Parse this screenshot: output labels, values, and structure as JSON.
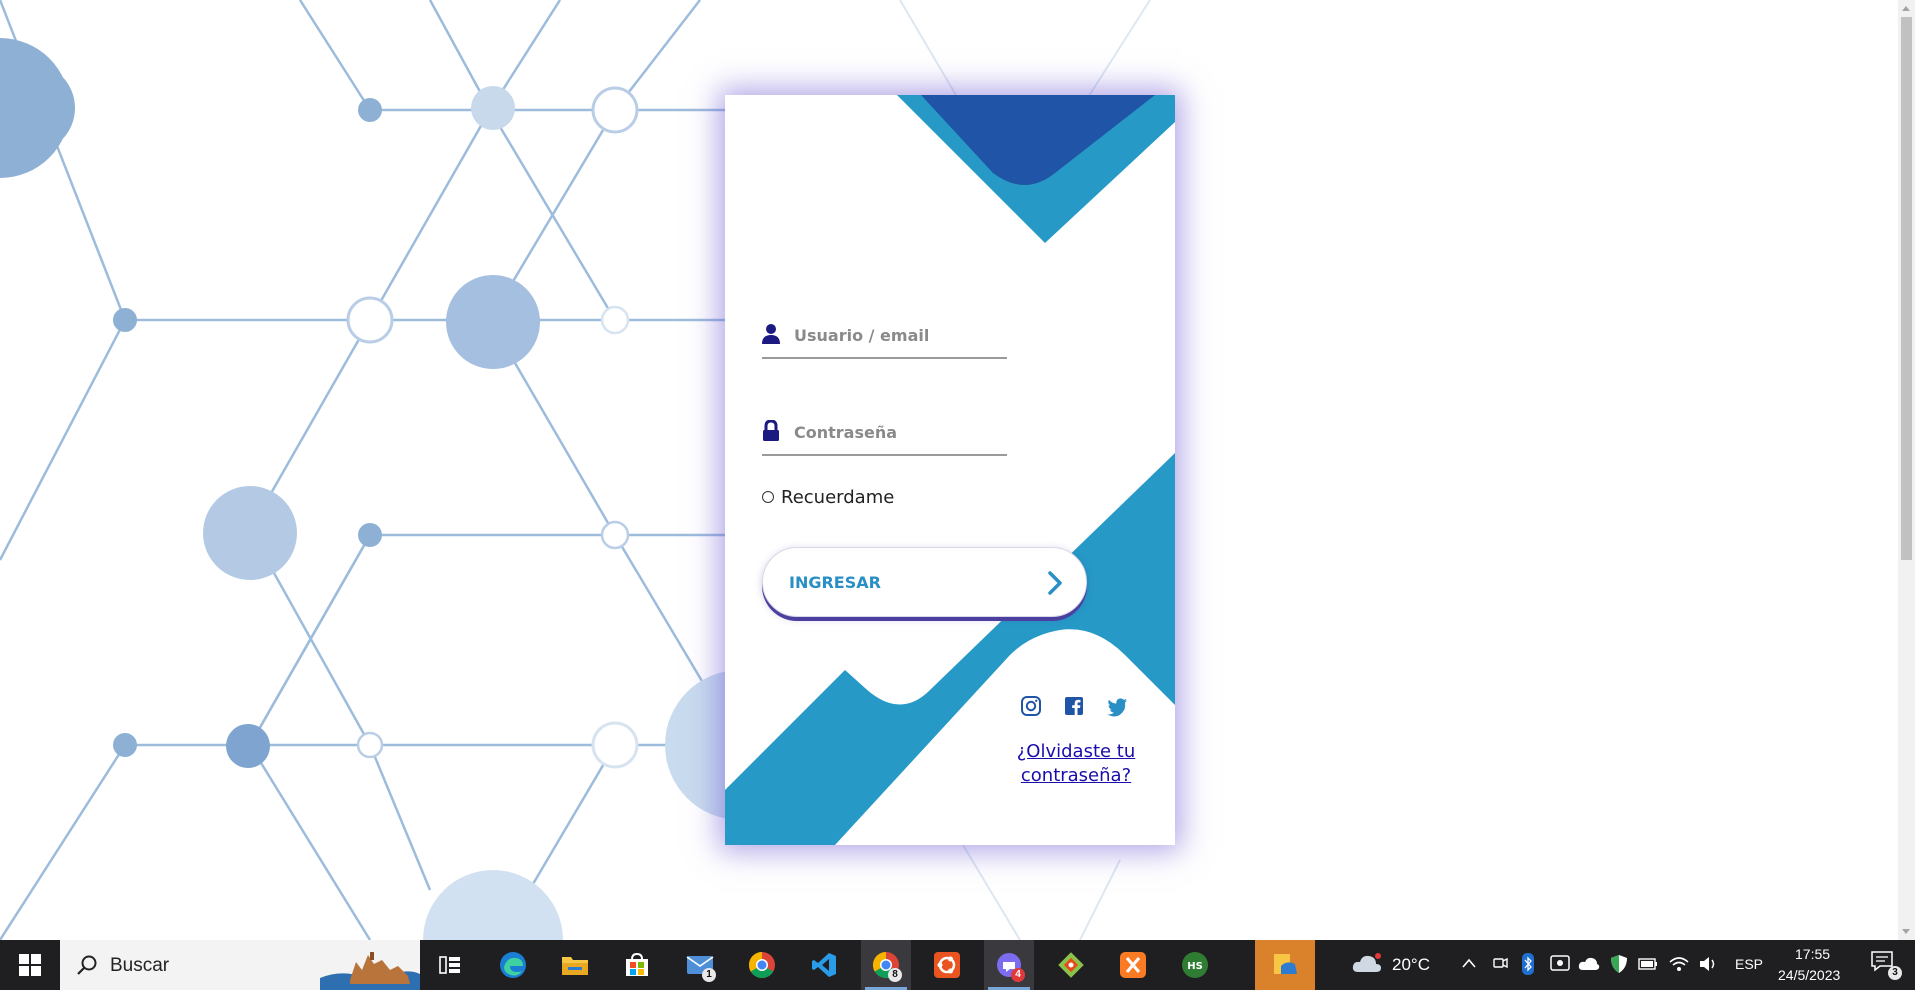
{
  "login": {
    "username_placeholder": "Usuario / email",
    "password_placeholder": "Contraseña",
    "remember_label": "Recuerdame",
    "submit_label": "INGRESAR",
    "forgot_line1": "¿Olvidaste tu",
    "forgot_line2": "contraseña?",
    "social_icons": [
      "instagram-icon",
      "facebook-icon",
      "twitter-icon"
    ]
  },
  "colors": {
    "accent_blue": "#2699c7",
    "dark_blue": "#2054a6",
    "icon_navy": "#1b1a80",
    "button_text": "#2a8fc4"
  },
  "taskbar": {
    "search_placeholder": "Buscar",
    "apps": [
      {
        "name": "task-view-icon",
        "badge": ""
      },
      {
        "name": "edge-icon",
        "badge": ""
      },
      {
        "name": "file-explorer-icon",
        "badge": ""
      },
      {
        "name": "microsoft-store-icon",
        "badge": ""
      },
      {
        "name": "mail-icon",
        "badge": "1"
      },
      {
        "name": "chrome-icon",
        "badge": ""
      },
      {
        "name": "vscode-icon",
        "badge": ""
      },
      {
        "name": "chrome-profile-icon",
        "badge": "8"
      },
      {
        "name": "ubuntu-icon",
        "badge": ""
      },
      {
        "name": "chat-app-icon",
        "badge": "4"
      },
      {
        "name": "git-icon",
        "badge": ""
      },
      {
        "name": "xampp-icon",
        "badge": ""
      },
      {
        "name": "heidisql-icon",
        "badge": ""
      },
      {
        "name": "folder-app-icon",
        "badge": ""
      }
    ],
    "weather_temp": "20°C",
    "language": "ESP",
    "time": "17:55",
    "date": "24/5/2023",
    "notification_count": "3"
  }
}
